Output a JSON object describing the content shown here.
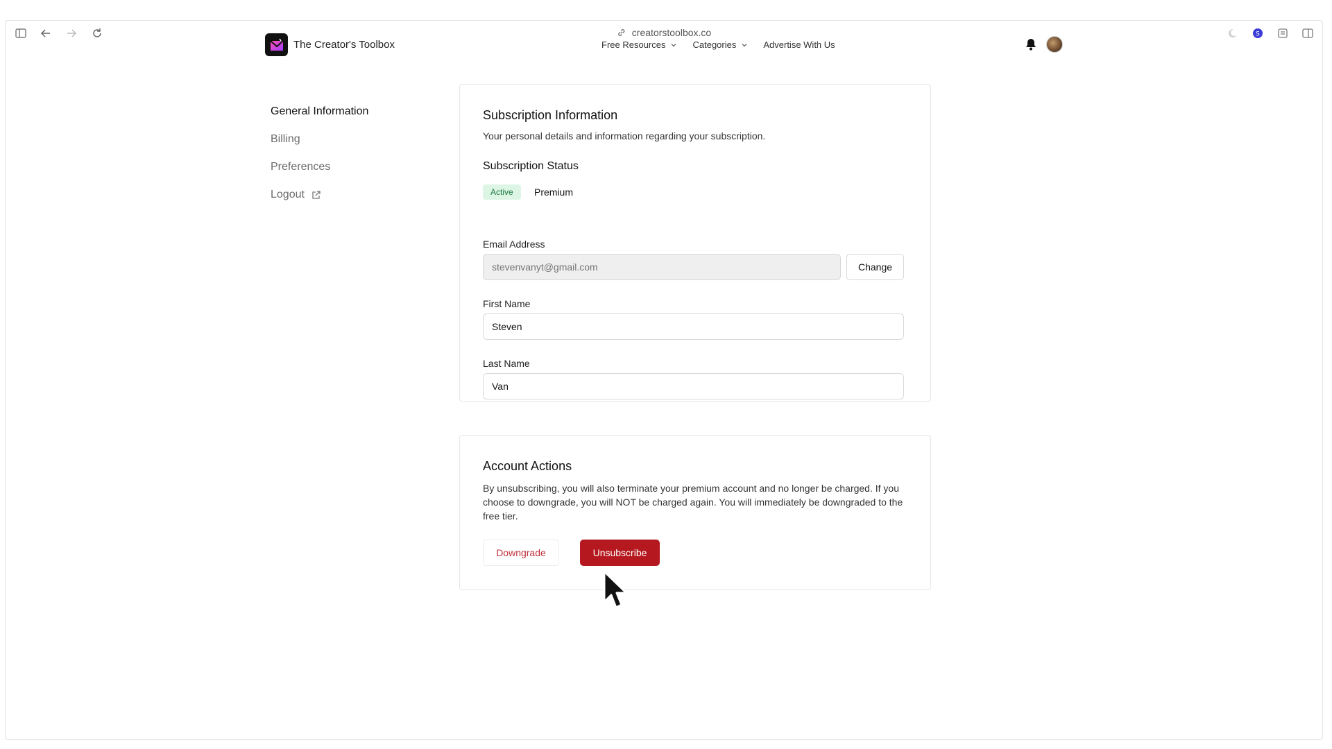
{
  "browser": {
    "url": "creatorstoolbox.co"
  },
  "nav": {
    "brand": "The Creator's Toolbox",
    "menu": [
      {
        "label": "Free Resources",
        "has_dropdown": true
      },
      {
        "label": "Categories",
        "has_dropdown": true
      },
      {
        "label": "Advertise With Us",
        "has_dropdown": false
      }
    ]
  },
  "sidebar": {
    "items": [
      {
        "label": "General Information",
        "active": true
      },
      {
        "label": "Billing",
        "active": false
      },
      {
        "label": "Preferences",
        "active": false
      },
      {
        "label": "Logout",
        "active": false
      }
    ]
  },
  "subscription": {
    "title": "Subscription Information",
    "subtitle": "Your personal details and information regarding your subscription.",
    "status_label": "Subscription Status",
    "status_badge": "Active",
    "plan": "Premium",
    "email_label": "Email Address",
    "email_value": "stevenvanyt@gmail.com",
    "change_button": "Change",
    "first_name_label": "First Name",
    "first_name_value": "Steven",
    "last_name_label": "Last Name",
    "last_name_value": "Van"
  },
  "actions": {
    "title": "Account Actions",
    "description": "By unsubscribing, you will also terminate your premium account and no longer be charged. If you choose to downgrade, you will NOT be charged again. You will immediately be downgraded to the free tier.",
    "downgrade_button": "Downgrade",
    "unsubscribe_button": "Unsubscribe"
  },
  "colors": {
    "accent_red": "#b5191f",
    "active_badge_bg": "#dcf5e5",
    "active_badge_text": "#1f7a43",
    "extension_badge": "#3b3bd6"
  }
}
